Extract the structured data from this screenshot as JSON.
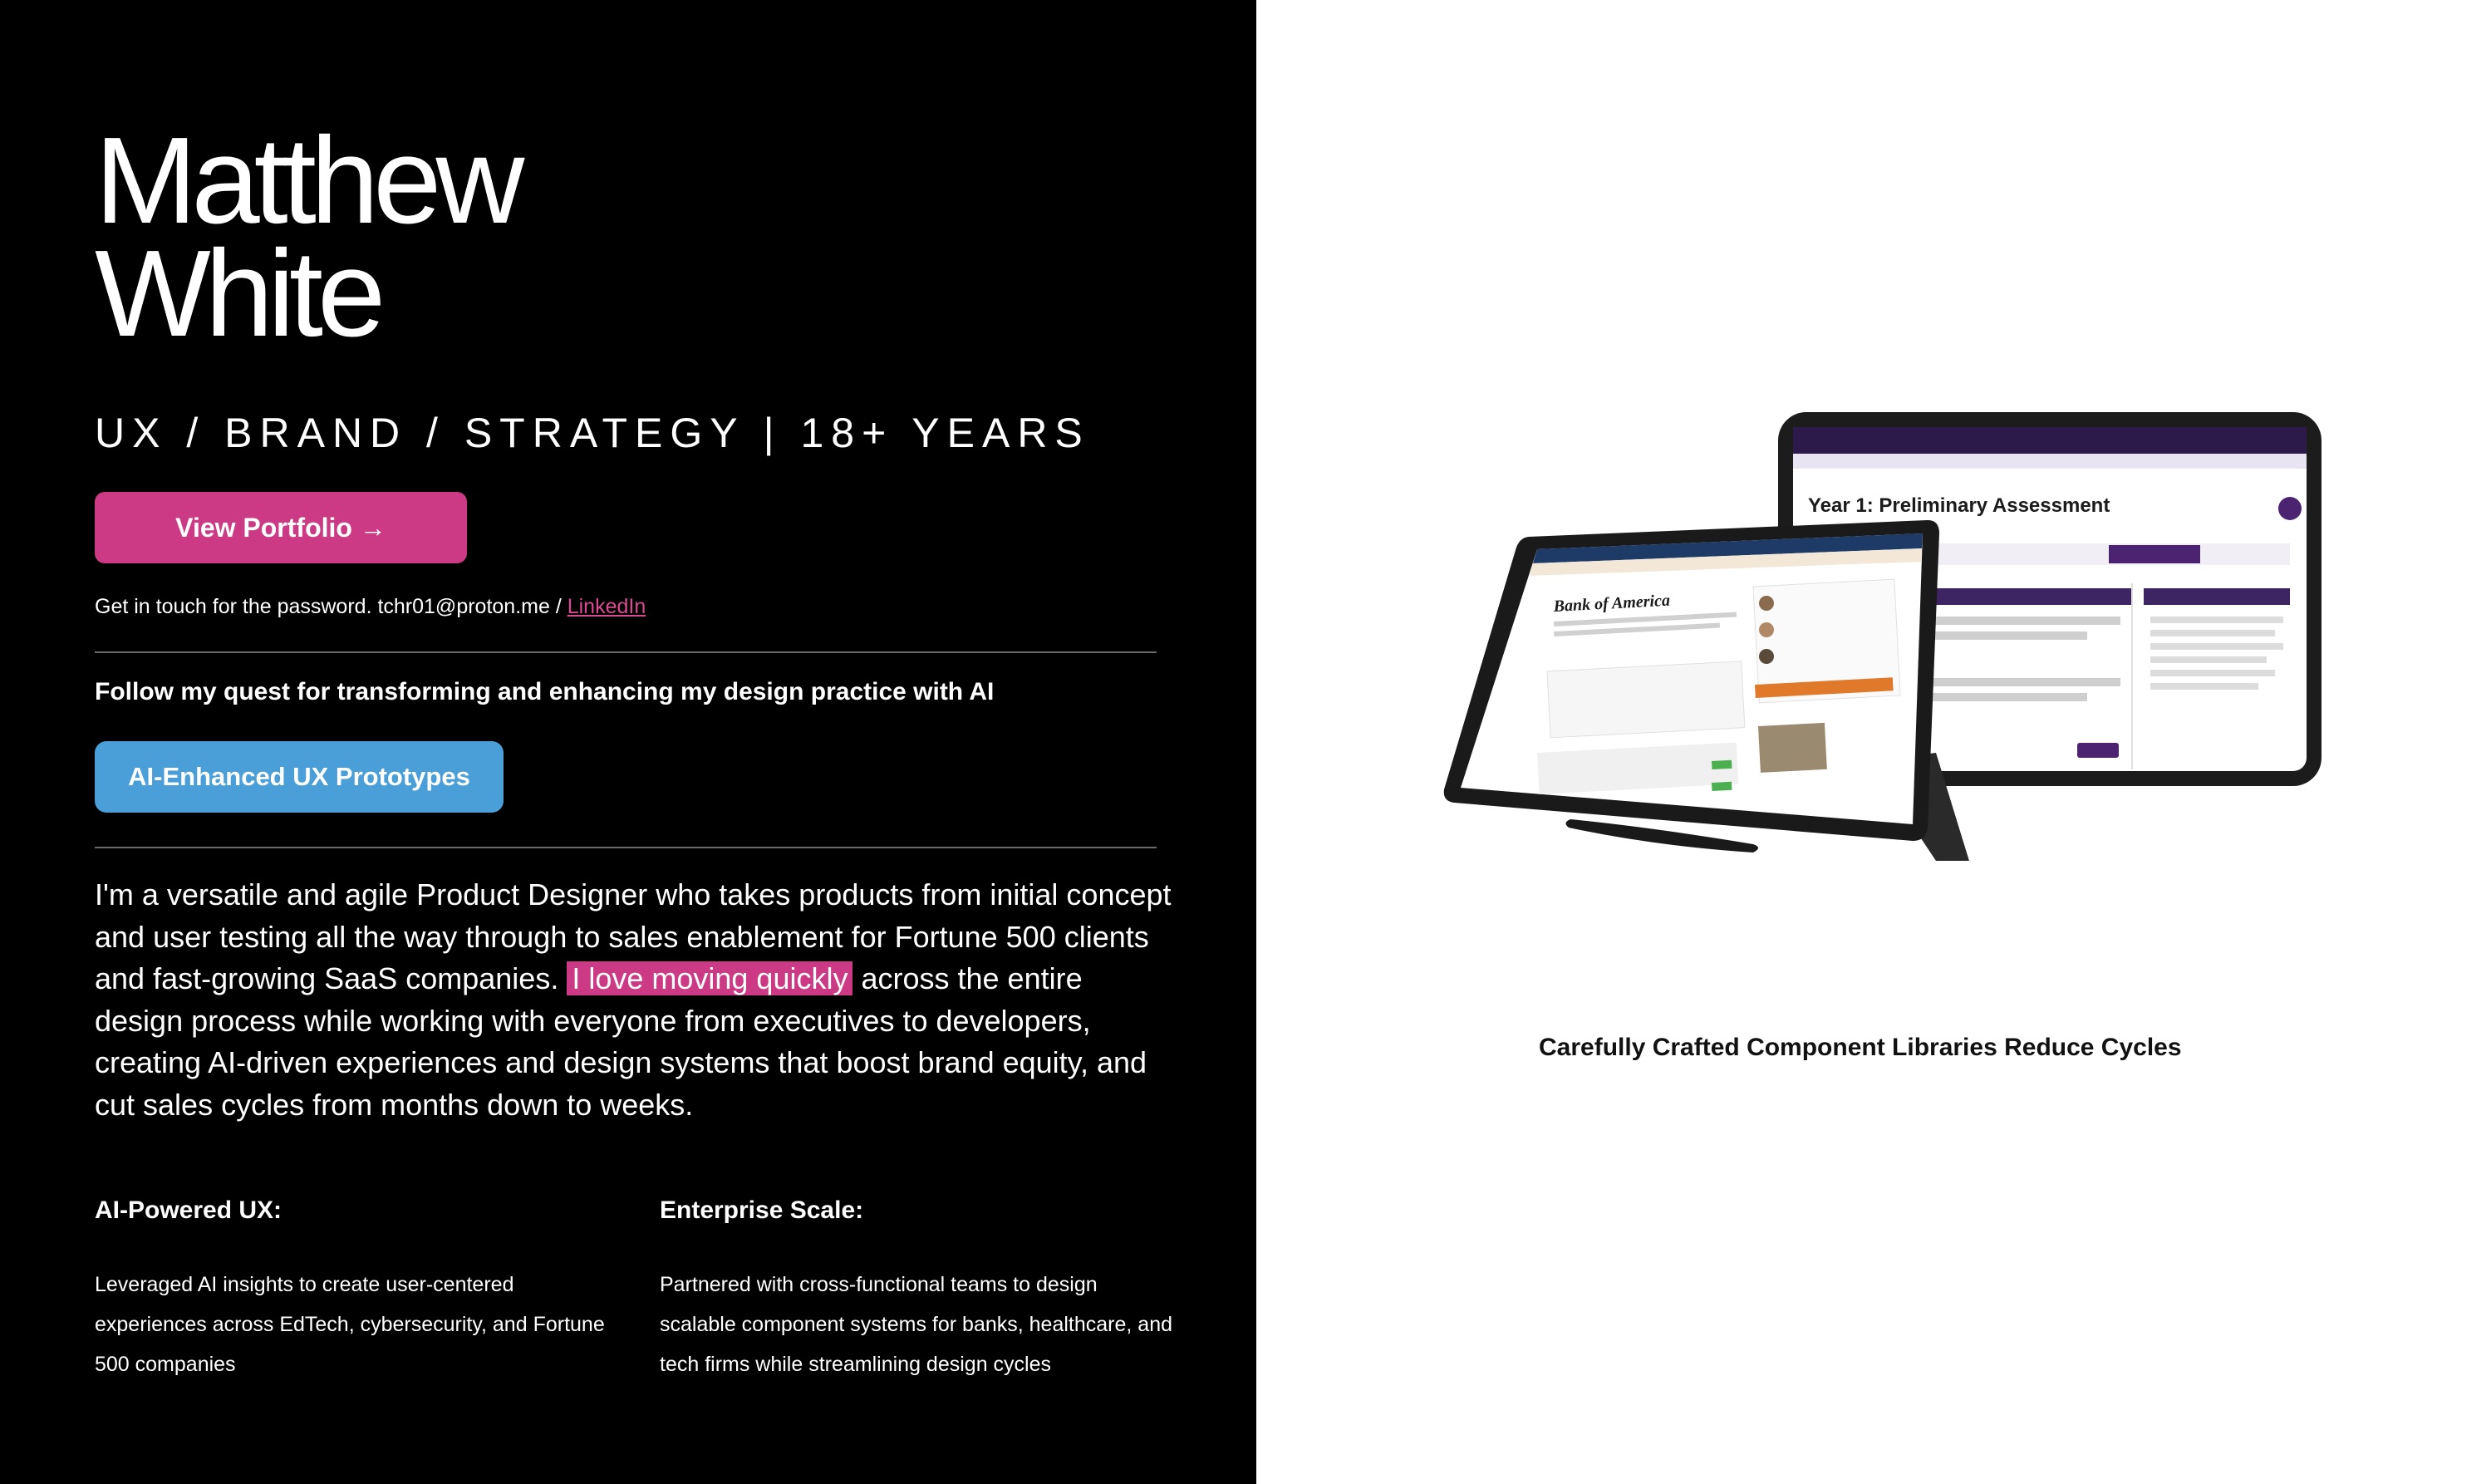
{
  "hero": {
    "name_line1": "Matthew",
    "name_line2": "White",
    "tagline": "UX / BRAND / STRATEGY | 18+ YEARS",
    "portfolio_button": "View Portfolio →",
    "contact_text": "Get in touch for the password. tchr01@proton.me / ",
    "contact_link": "LinkedIn",
    "follow_text": "Follow my quest for transforming and enhancing my design practice with AI",
    "ai_button": "AI-Enhanced UX Prototypes"
  },
  "bio": {
    "before": "I'm a versatile and agile Product Designer who takes products from initial concept and user testing all the way through to sales enablement for Fortune 500 clients and fast-growing SaaS companies. ",
    "highlight": "I love moving quickly",
    "after": " across the entire design process while working with everyone from executives to developers, creating AI-driven experiences and design systems that boost brand equity, and cut sales cycles from months down to weeks."
  },
  "features": [
    {
      "title": "AI-Powered UX:",
      "text": "Leveraged AI insights to create user-centered experiences across EdTech, cybersecurity, and Fortune 500 companies"
    },
    {
      "title": "Enterprise Scale:",
      "text": "Partnered with cross-functional teams to design scalable component systems for banks, healthcare, and tech firms while streamlining design cycles"
    }
  ],
  "showcase": {
    "caption": "Carefully Crafted Component Libraries Reduce Cycles",
    "tablet_back_title": "Year 1: Preliminary Assessment",
    "tablet_front_title": "Bank of America"
  },
  "colors": {
    "accent_pink": "#cc3a85",
    "accent_blue": "#4a9fd8",
    "panel_black": "#000000",
    "mock_purple": "#4b2370"
  }
}
